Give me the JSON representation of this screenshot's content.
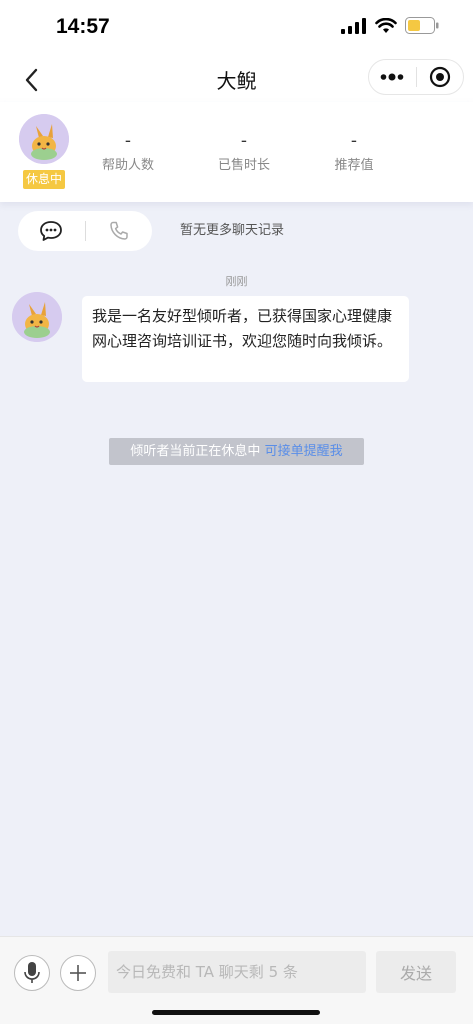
{
  "status_bar": {
    "time": "14:57"
  },
  "nav": {
    "title": "大鲵",
    "back_icon": "chevron-left-icon",
    "more_icon": "more-dots-icon",
    "close_icon": "target-icon"
  },
  "profile": {
    "status_badge": "休息中",
    "stats": [
      {
        "value": "-",
        "label": "帮助人数"
      },
      {
        "value": "-",
        "label": "已售时长"
      },
      {
        "value": "-",
        "label": "推荐值"
      }
    ]
  },
  "chat": {
    "no_more_history": "暂无更多聊天记录",
    "time_label": "刚刚",
    "messages": [
      {
        "sender": "listener",
        "text": "我是一名友好型倾听者，已获得国家心理健康网心理咨询培训证书，欢迎您随时向我倾诉。"
      }
    ],
    "notice": {
      "text": "倾听者当前正在休息中",
      "link": "可接单提醒我"
    }
  },
  "input_bar": {
    "placeholder": "今日免费和 TA 聊天剩 5 条",
    "send_label": "发送"
  },
  "colors": {
    "background": "#eef0f8",
    "badge": "#f5c842",
    "link": "#5a8ee8",
    "notice_bg": "#c2c4cc"
  }
}
